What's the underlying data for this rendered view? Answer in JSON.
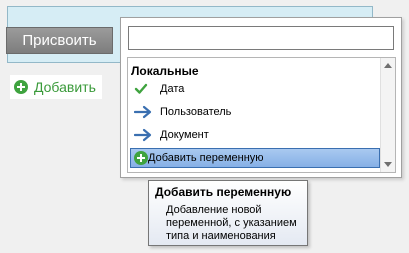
{
  "assign_button": {
    "label": "Присвоить"
  },
  "add_link": {
    "label": "Добавить"
  },
  "popup": {
    "search": {
      "value": "",
      "placeholder": ""
    },
    "group": {
      "title": "Локальные"
    },
    "items": [
      {
        "label": "Дата",
        "icon": "check-icon"
      },
      {
        "label": "Пользователь",
        "icon": "arrow-right-icon"
      },
      {
        "label": "Документ",
        "icon": "arrow-right-icon"
      },
      {
        "label": "Добавить переменную",
        "icon": "plus-circle-icon",
        "selected": true
      }
    ]
  },
  "tooltip": {
    "title": "Добавить переменную",
    "body": "Добавление новой\nпеременной, с указанием\nтипа и наименования"
  },
  "colors": {
    "accent_green": "#3fa33f",
    "arrow_blue": "#3a6fb0",
    "selection_bg": "#a9c9f0"
  }
}
